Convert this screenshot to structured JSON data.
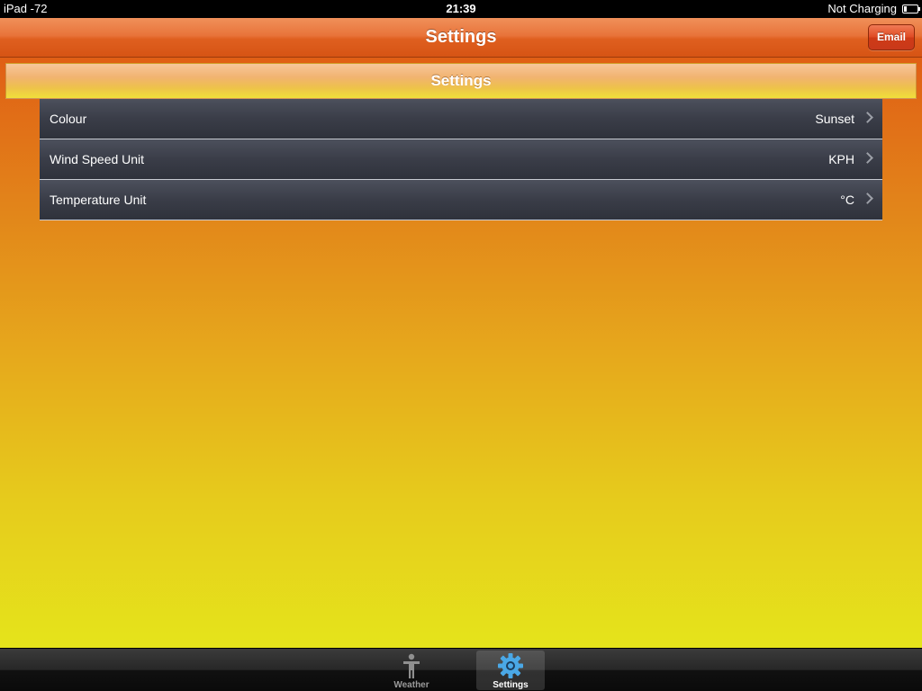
{
  "status_bar": {
    "carrier": "iPad -72",
    "time": "21:39",
    "battery_status": "Not Charging"
  },
  "nav_bar": {
    "title": "Settings",
    "email_label": "Email"
  },
  "section": {
    "header": "Settings"
  },
  "settings": [
    {
      "label": "Colour",
      "value": "Sunset"
    },
    {
      "label": "Wind Speed Unit",
      "value": "KPH"
    },
    {
      "label": "Temperature Unit",
      "value": "°C"
    }
  ],
  "tab_bar": {
    "tabs": [
      {
        "label": "Weather",
        "icon": "person-icon",
        "selected": false
      },
      {
        "label": "Settings",
        "icon": "gear-icon",
        "selected": true
      }
    ]
  },
  "colors": {
    "nav_accent": "#e06524",
    "email_button": "#d9411d",
    "gear_selected": "#4aa8e6"
  }
}
